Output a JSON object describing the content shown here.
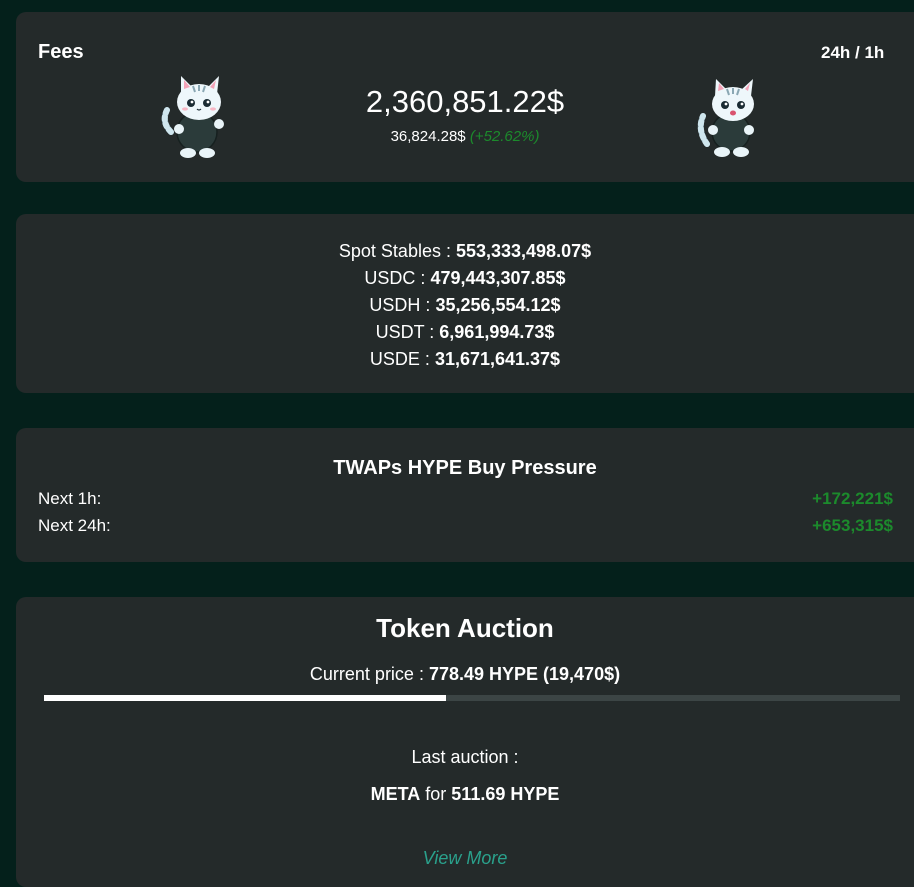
{
  "fees": {
    "title": "Fees",
    "period": "24h / 1h",
    "amount": "2,360,851.22$",
    "hourly_amount": "36,824.28$",
    "hourly_change": "(+52.62%)"
  },
  "stables": {
    "items": [
      {
        "label": "Spot Stables : ",
        "value": "553,333,498.07$"
      },
      {
        "label": "USDC : ",
        "value": "479,443,307.85$"
      },
      {
        "label": "USDH : ",
        "value": "35,256,554.12$"
      },
      {
        "label": "USDT : ",
        "value": "6,961,994.73$"
      },
      {
        "label": "USDE : ",
        "value": "31,671,641.37$"
      }
    ]
  },
  "twap": {
    "title": "TWAPs HYPE Buy Pressure",
    "rows": [
      {
        "label": "Next 1h:",
        "value": "+172,221$"
      },
      {
        "label": "Next 24h:",
        "value": "+653,315$"
      }
    ]
  },
  "auction": {
    "title": "Token Auction",
    "price_label": "Current price : ",
    "price_value": "778.49 HYPE (19,470$)",
    "progress": 0.47,
    "last_label": "Last auction :",
    "last_token": "META",
    "last_for": " for ",
    "last_amount": "511.69 HYPE",
    "view_more": "View More"
  },
  "colors": {
    "background": "#04201b",
    "card": "#242a2a",
    "positive": "#1c8a2c",
    "link": "#2aa18c"
  },
  "icons": {
    "mascot": "cat-mascot-icon"
  }
}
